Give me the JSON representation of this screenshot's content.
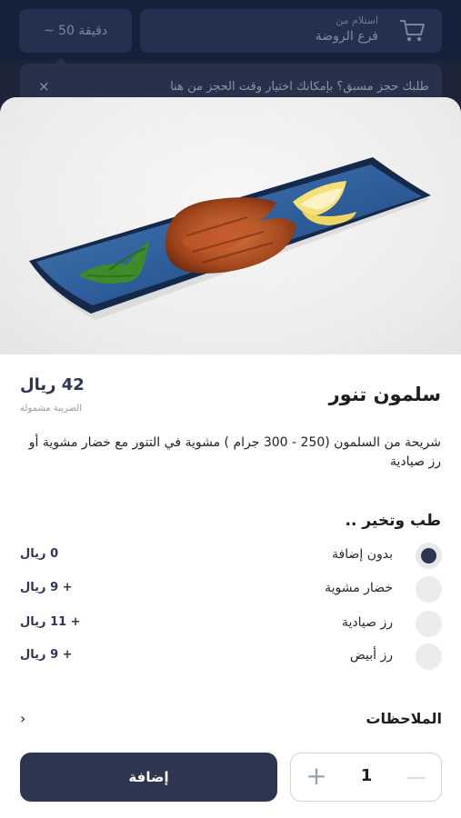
{
  "header": {
    "pickup_label": "استلام من",
    "pickup_branch": "فرع الروضة",
    "time_estimate": "~ 50 دقيقة"
  },
  "banner": {
    "text": "طلبك حجز مسبق؟ بإمكانك اختيار وقت الحجز من هنا",
    "close_symbol": "×"
  },
  "product": {
    "name": "سلمون تنور",
    "price": "42 ريال",
    "tax_note": "الضريبة مشمولة",
    "description": "شريحة من السلمون (250 - 300 جرام ) مشوية في التنور مع خضار مشوية أو رز صيادية"
  },
  "options_section": {
    "title": "طب وتخير ..",
    "items": [
      {
        "label": "بدون إضافة",
        "price": "0 ريال",
        "selected": true
      },
      {
        "label": "خضار مشوية",
        "price": "+ 9 ريال",
        "selected": false
      },
      {
        "label": "رز صيادية",
        "price": "+ 11 ريال",
        "selected": false
      },
      {
        "label": "رز أبيض",
        "price": "+ 9 ريال",
        "selected": false
      }
    ]
  },
  "notes": {
    "label": "الملاحظات",
    "chevron": "›"
  },
  "footer": {
    "add_label": "إضافة",
    "quantity": "1",
    "plus_symbol": "+"
  },
  "colors": {
    "primary": "#2e3550",
    "background_dim": "#1b2236",
    "radio_idle": "#ececec"
  },
  "icons": {
    "cart": "cart-icon",
    "close": "close-icon",
    "chevron": "chevron-right-icon",
    "plus": "plus-icon",
    "minus": "minus-icon"
  }
}
